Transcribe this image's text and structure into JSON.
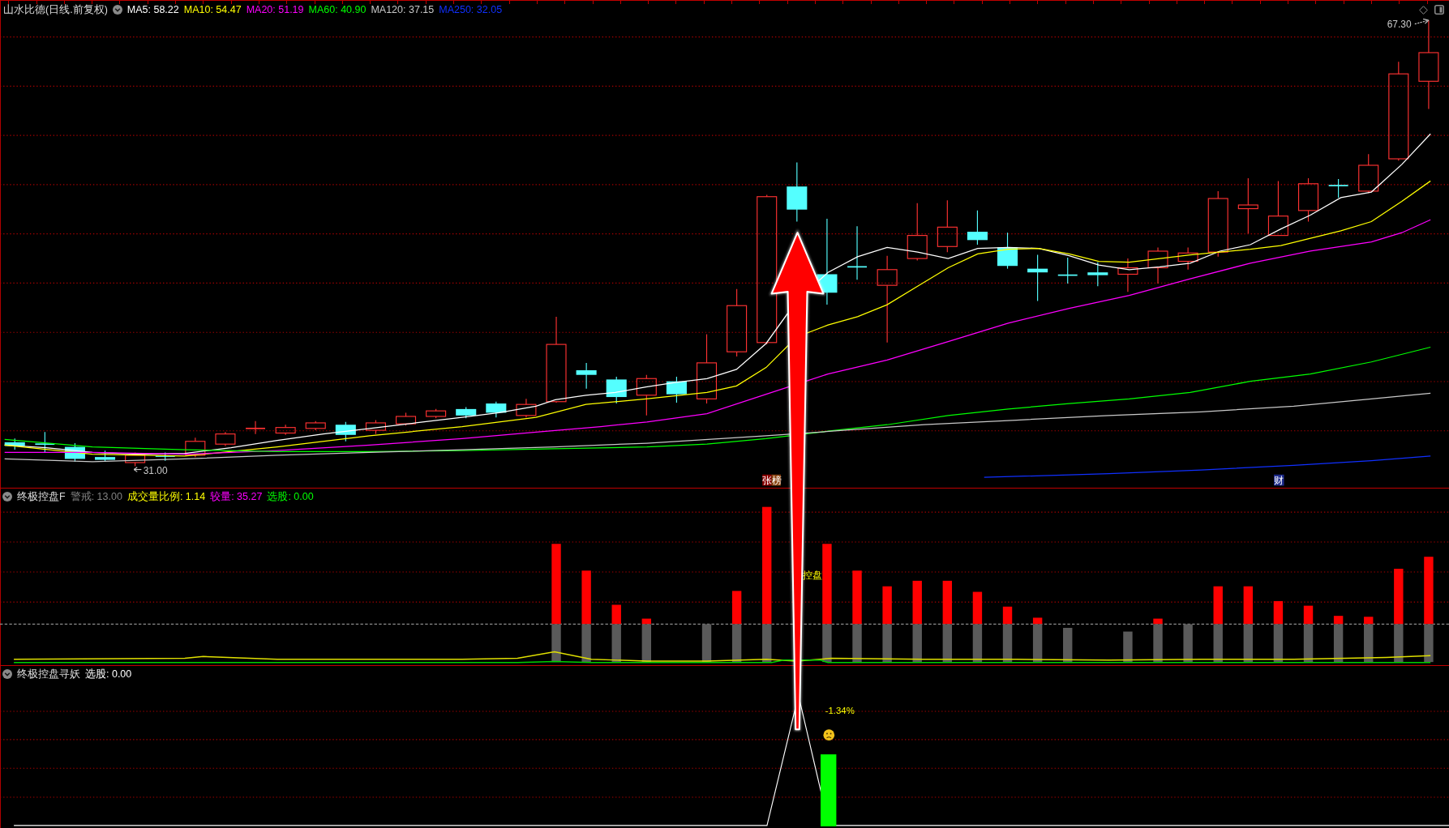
{
  "main_panel": {
    "title": "山水比德(日线.前复权)",
    "indicators": [
      {
        "label": "MA5: 58.22",
        "color": "#ffffff"
      },
      {
        "label": "MA10: 54.47",
        "color": "#ffff00"
      },
      {
        "label": "MA20: 51.19",
        "color": "#ff00ff"
      },
      {
        "label": "MA60: 40.90",
        "color": "#00ff00"
      },
      {
        "label": "MA120: 37.15",
        "color": "#c8c8c8"
      },
      {
        "label": "MA250: 32.05",
        "color": "#1030ff"
      }
    ],
    "max_price_label": "67.30",
    "min_price_label": "31.00",
    "event_markers": [
      {
        "text": "张榜"
      },
      {
        "text": "财"
      }
    ]
  },
  "volume_panel": {
    "title": "终极控盘F",
    "indicators": [
      {
        "label": "警戒: 13.00",
        "color": "#808080"
      },
      {
        "label": "成交量比例: 1.14",
        "color": "#ffff00"
      },
      {
        "label": "较量: 35.27",
        "color": "#ff00ff"
      },
      {
        "label": "选股: 0.00",
        "color": "#00ff00"
      }
    ],
    "signal_label": "控盘"
  },
  "signal_panel": {
    "title": "终极控盘寻妖",
    "indicators": [
      {
        "label": "选股: 0.00",
        "color": "#ffffff"
      }
    ],
    "change_label": "-1.34%"
  }
}
